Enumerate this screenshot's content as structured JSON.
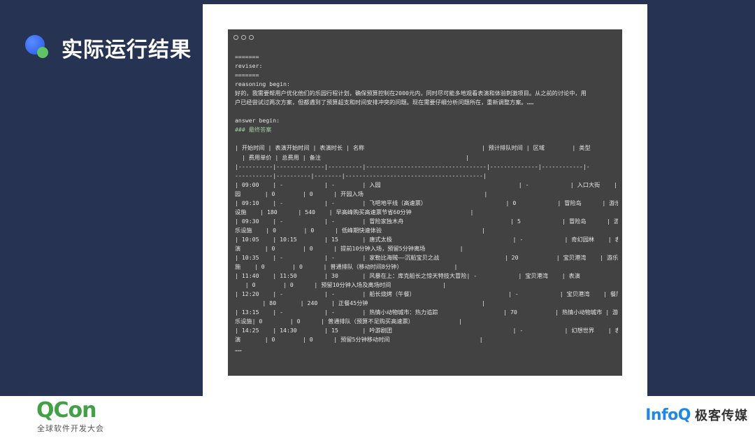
{
  "slide": {
    "title": "实际运行结果"
  },
  "terminal": {
    "lines": [
      "=======",
      "reviser:",
      "=======",
      "reasoning begin:",
      "好的，我需要帮用户优化他们的乐园行程计划，确保预算控制在2000元内，同时尽可能多地观看表演和体验刺激项目。从之前的讨论中，用",
      "户已经尝试过两次方案，但都遇到了预算超支和时间安排冲突的问题。现在需要仔细分析问题所在，重新调整方案。……",
      "",
      "answer begin:",
      "### 最终答案",
      "",
      "| 开始时间 | 表演开始时间 | 表演时长 | 名称                                  | 预计排队时间 | 区域        | 类型",
      "  | 费用单价 | 总费用 | 备注                                          |",
      "|----------|--------------|----------|-----------------------------------|--------------|------------|-",
      "-----------|----------|--------|----------------------------------------|",
      "| 09:00    | -            | -        | 入园                                        | -            | 入口大街    | 入",
      "园       | 0        | 0      | 开园入场                                   |",
      "| 09:10    | -            | -        | 飞吧地平线（高速票）                       | 0            | 冒险岛      | 游乐",
      "设施    | 180      | 540    | 早高峰购买高速票节省60分钟                 |",
      "| 09:30    | -            | -        | 冒险家独木舟                               | 5            | 冒险岛      | 游",
      "乐设施    | 0        | 0      | 低峰期快速体验                             |",
      "| 10:05    | 10:15        | 15       | 唐式太极                                   | -            | 奇幻园林    | 表",
      "演       | 0        | 0      | 提前10分钟入场，预留5分钟离场          |",
      "| 10:35    | -            | -        | 家勒比海贼——沉船宝贝之战                   | 20           | 宝贝港湾    | 游乐设",
      "施    | 0        | 0      | 普通排队（移动时间8分钟）               |",
      "| 11:40    | 11:50        | 30       | 风暴在上：库克船长之惊天特技大冒险| -            | 宝贝港湾    | 表演",
      "   | 0        | 0      | 预留10分钟入场及离场时间               |",
      "| 12:20    | -            | -        | 船长烧烤（午餐）                           | -            | 宝贝港湾    | 餐厅",
      "        | 80       | 240    | 正餐45分钟                                 |",
      "| 13:15    | -            | -        | 热情小动物城市：热力追踪                   | 70           | 热情小动物城市 | 游",
      "乐设施| 0        | 0      | 普通排队（预算不足购买高速票）             |",
      "| 14:25    | 14:30        | 15       | 吟游剧团                                   | -            | 幻想世界    | 表",
      "演       | 0        | 0      | 预留5分钟移动时间                          |",
      "……"
    ]
  },
  "footer": {
    "qcon_logo": "QCon",
    "qcon_subtitle": "全球软件开发大会",
    "infoq_logo": "InfoQ",
    "infoq_subtitle": "极客传媒"
  }
}
